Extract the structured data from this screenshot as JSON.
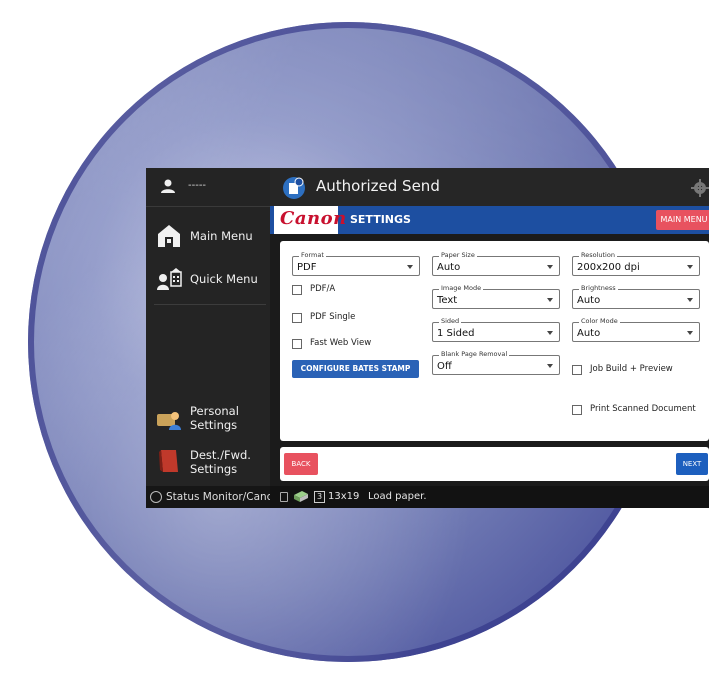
{
  "nav": {
    "user_name": "-----",
    "items": [
      {
        "label": "Main Menu",
        "icon": "home-icon"
      },
      {
        "label": "Quick Menu",
        "icon": "quick-menu-icon"
      },
      {
        "label_line1": "Personal",
        "label_line2": "Settings",
        "icon": "personal-settings-icon"
      },
      {
        "label_line1": "Dest./Fwd.",
        "label_line2": "Settings",
        "icon": "book-icon"
      }
    ],
    "status_monitor": "Status Monitor/Cancel"
  },
  "header": {
    "title": "Authorized Send",
    "logo": "Canon",
    "section": "SETTINGS",
    "main_menu_label": "MAIN MENU"
  },
  "form": {
    "format": {
      "label": "Format",
      "value": "PDF"
    },
    "pdfa_label": "PDF/A",
    "pdf_single_label": "PDF Single",
    "fast_web_view_label": "Fast Web View",
    "bates_button": "CONFIGURE BATES STAMP",
    "paper_size": {
      "label": "Paper Size",
      "value": "Auto"
    },
    "image_mode": {
      "label": "Image Mode",
      "value": "Text"
    },
    "sided": {
      "label": "Sided",
      "value": "1 Sided"
    },
    "blank_page_removal": {
      "label": "Blank Page Removal",
      "value": "Off"
    },
    "resolution": {
      "label": "Resolution",
      "value": "200x200 dpi"
    },
    "brightness": {
      "label": "Brightness",
      "value": "Auto"
    },
    "color_mode": {
      "label": "Color Mode",
      "value": "Auto"
    },
    "job_build_label": "Job Build + Preview",
    "print_scanned_label": "Print Scanned Document"
  },
  "footer": {
    "back_label": "BACK",
    "next_label": "NEXT"
  },
  "status": {
    "tray": "3",
    "size": "13x19",
    "message": "Load paper."
  },
  "colors": {
    "accent_blue": "#1d4fa1",
    "button_red": "#e8525f",
    "button_blue": "#2a62b6",
    "canon_red": "#c8102e"
  }
}
